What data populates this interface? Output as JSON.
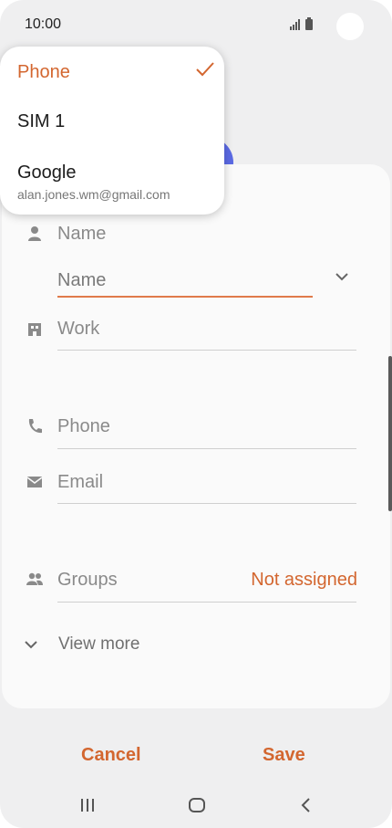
{
  "status_bar": {
    "time": "10:00"
  },
  "account_menu": {
    "items": [
      {
        "label": "Phone",
        "selected": true
      },
      {
        "label": "SIM 1"
      },
      {
        "label": "Google",
        "email": "alan.jones.wm@gmail.com"
      }
    ]
  },
  "form": {
    "name_label": "Name",
    "name_input_placeholder": "Name",
    "work_label": "Work",
    "phone_label": "Phone",
    "email_label": "Email",
    "groups_label": "Groups",
    "groups_value": "Not assigned",
    "view_more_label": "View more"
  },
  "actions": {
    "cancel_label": "Cancel",
    "save_label": "Save"
  },
  "colors": {
    "accent": "#d3662f",
    "avatar": "#5b6ae4",
    "background": "#efeff0",
    "card": "#fafafa"
  },
  "icons": [
    "person-icon",
    "building-icon",
    "phone-icon",
    "mail-icon",
    "group-icon",
    "chevron-down-icon",
    "check-icon",
    "recent-apps-icon",
    "home-icon",
    "back-icon"
  ]
}
